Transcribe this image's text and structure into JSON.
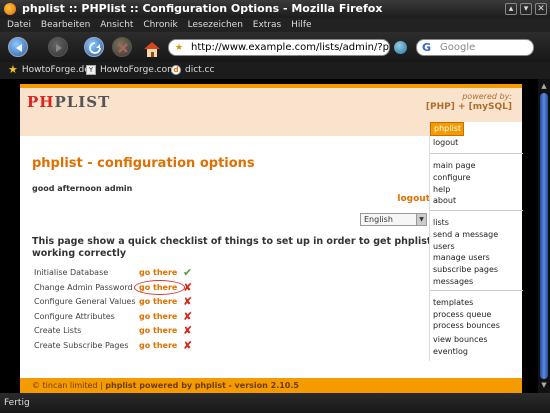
{
  "window": {
    "title": "phplist :: PHPlist :: Configuration Options - Mozilla Firefox",
    "controls": [
      "▴",
      "▾",
      "✕"
    ]
  },
  "menu": [
    "Datei",
    "Bearbeiten",
    "Ansicht",
    "Chronik",
    "Lesezeichen",
    "Extras",
    "Hilfe"
  ],
  "nav": {
    "url": "http://www.example.com/lists/admin/?page=",
    "search_placeholder": "Google",
    "search_engine_icon": "G"
  },
  "bookmarks": [
    {
      "label": "HowtoForge.de",
      "icon": "star-icon"
    },
    {
      "label": "HowtoForge.com",
      "icon": "favicon"
    },
    {
      "label": "dict.cc",
      "icon": "dictcc-icon"
    }
  ],
  "page": {
    "logo_ph": "PH",
    "logo_rest": "PLIST",
    "powered_label": "powered by:",
    "powered_tech": "[PHP] + [mySQL]",
    "heading": "phplist - configuration options",
    "greeting": "good afternoon admin",
    "logout": "logout",
    "language": "English",
    "intro": "This page show a quick checklist of things to set up in order to get phplist working correctly",
    "checklist": [
      {
        "label": "Initialise Database",
        "link": "go there",
        "status": "done",
        "mark": "✔"
      },
      {
        "label": "Change Admin Password",
        "link": "go there",
        "status": "todo",
        "mark": "✘"
      },
      {
        "label": "Configure General Values",
        "link": "go there",
        "status": "todo",
        "mark": "✘"
      },
      {
        "label": "Configure Attributes",
        "link": "go there",
        "status": "todo",
        "mark": "✘"
      },
      {
        "label": "Create Lists",
        "link": "go there",
        "status": "todo",
        "mark": "✘"
      },
      {
        "label": "Create Subscribe Pages",
        "link": "go there",
        "status": "todo",
        "mark": "✘"
      }
    ],
    "sidemenu": {
      "active": "phplist",
      "group0": [
        "logout"
      ],
      "group1": [
        "main page",
        "configure",
        "help",
        "about"
      ],
      "group2": [
        "lists",
        "send a message",
        "users",
        "manage users",
        "subscribe pages",
        "messages"
      ],
      "group3": [
        "templates",
        "process queue",
        "process bounces",
        "view bounces",
        "eventlog"
      ]
    },
    "footer": {
      "copyright": "© tincan limited",
      "separator": " | ",
      "powered": "phplist powered by",
      "brand": "phplist",
      "version": "- version 2.10.5"
    }
  },
  "status": "Fertig",
  "colors": {
    "accent": "#f59b00",
    "link": "#e07000",
    "header_bg": "#f9e3cc"
  }
}
